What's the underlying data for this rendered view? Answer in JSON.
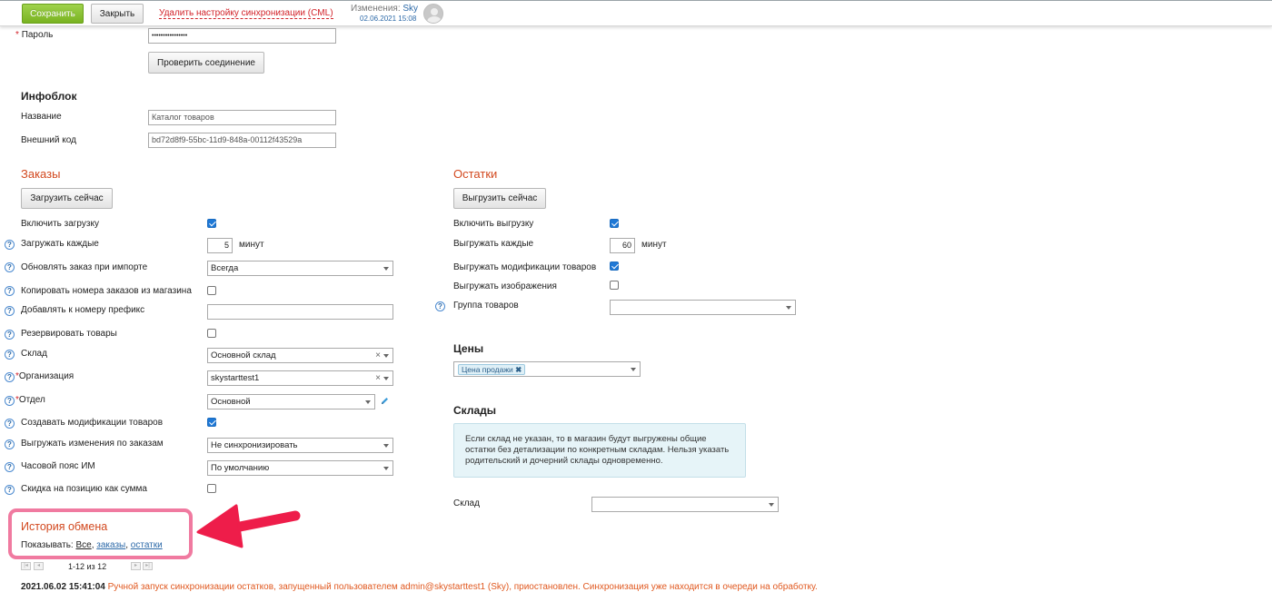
{
  "topbar": {
    "save_label": "Сохранить",
    "close_label": "Закрыть",
    "delete_link": "Удалить настройку синхронизации (CML)",
    "changes_label": "Изменения:",
    "changes_user": "Sky",
    "changes_date": "02.06.2021 15:08"
  },
  "connection": {
    "password_label": "Пароль",
    "password_value": "••••••••••••••••",
    "check_button": "Проверить соединение"
  },
  "iblock": {
    "title": "Инфоблок",
    "name_label": "Название",
    "name_value": "Каталог товаров",
    "xml_label": "Внешний код",
    "xml_value": "bd72d8f9-55bc-11d9-848a-00112f43529a"
  },
  "orders": {
    "title": "Заказы",
    "load_button": "Загрузить сейчас",
    "enable_label": "Включить загрузку",
    "interval_label": "Загружать каждые",
    "interval_value": "5",
    "interval_unit": "минут",
    "update_label": "Обновлять заказ при импорте",
    "update_value": "Всегда",
    "copy_numbers_label": "Копировать номера заказов из магазина",
    "prefix_label": "Добавлять к номеру префикс",
    "prefix_value": "",
    "reserve_label": "Резервировать товары",
    "store_label": "Склад",
    "store_value": "Основной склад",
    "org_label": "Организация",
    "org_value": "skystarttest1",
    "dept_label": "Отдел",
    "dept_value": "Основной",
    "create_mods_label": "Создавать модификации товаров",
    "export_changes_label": "Выгружать изменения по заказам",
    "export_changes_value": "Не синхронизировать",
    "tz_label": "Часовой пояс ИМ",
    "tz_value": "По умолчанию",
    "discount_label": "Скидка на позицию как сумма"
  },
  "stocks": {
    "title": "Остатки",
    "export_button": "Выгрузить сейчас",
    "enable_label": "Включить выгрузку",
    "interval_label": "Выгружать каждые",
    "interval_value": "60",
    "interval_unit": "минут",
    "mods_label": "Выгружать модификации товаров",
    "images_label": "Выгружать изображения",
    "group_label": "Группа товаров",
    "group_value": ""
  },
  "prices": {
    "title": "Цены",
    "tag": "Цена продажи"
  },
  "warehouses": {
    "title": "Склады",
    "info": "Если склад не указан, то в магазин будут выгружены общие остатки без детализации по конкретным складам. Нельзя указать родительский и дочерний склады одновременно.",
    "store_label": "Склад",
    "store_value": ""
  },
  "history": {
    "title": "История обмена",
    "show_label": "Показывать:",
    "filter_all": "Все",
    "filter_orders": "заказы",
    "filter_stocks": "остатки",
    "pagination": "1-12 из 12",
    "log_date": "2021.06.02 15:41:04",
    "log_text": "Ручной запуск синхронизации остатков, запущенный пользователем admin@skystarttest1 (Sky), приостановлен. Синхронизация уже находится в очереди на обработку."
  },
  "colors": {
    "accent_green": "#79b321",
    "section_red": "#d2481e",
    "link_blue": "#2c69a8",
    "highlight_pink": "#f07aa0",
    "arrow_red": "#ee1d4a"
  }
}
